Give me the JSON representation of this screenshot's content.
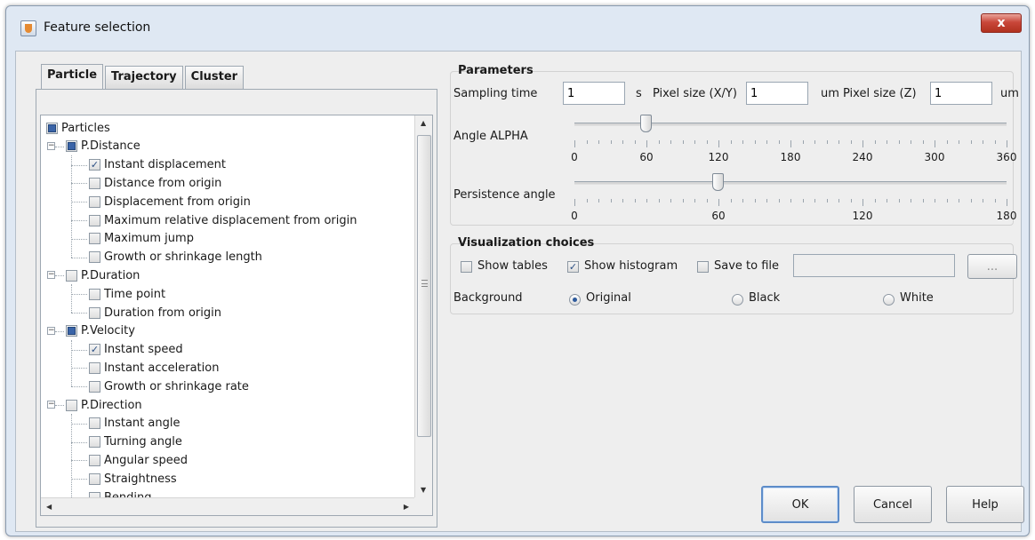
{
  "window": {
    "title": "Feature selection",
    "close_glyph": "x"
  },
  "tabs": [
    {
      "label": "Particle",
      "active": true
    },
    {
      "label": "Trajectory",
      "active": false
    },
    {
      "label": "Cluster",
      "active": false
    }
  ],
  "tree": {
    "root": {
      "label": "Particles",
      "state": "partial"
    },
    "groups": [
      {
        "label": "P.Distance",
        "state": "partial",
        "items": [
          {
            "label": "Instant displacement",
            "checked": true
          },
          {
            "label": "Distance from origin",
            "checked": false
          },
          {
            "label": "Displacement from origin",
            "checked": false
          },
          {
            "label": "Maximum relative displacement from origin",
            "checked": false
          },
          {
            "label": "Maximum jump",
            "checked": false
          },
          {
            "label": "Growth or shrinkage length",
            "checked": false
          }
        ]
      },
      {
        "label": "P.Duration",
        "state": "unchecked",
        "items": [
          {
            "label": "Time point",
            "checked": false
          },
          {
            "label": "Duration from origin",
            "checked": false
          }
        ]
      },
      {
        "label": "P.Velocity",
        "state": "partial",
        "items": [
          {
            "label": "Instant speed",
            "checked": true
          },
          {
            "label": "Instant acceleration",
            "checked": false
          },
          {
            "label": "Growth or shrinkage rate",
            "checked": false
          }
        ]
      },
      {
        "label": "P.Direction",
        "state": "unchecked",
        "items": [
          {
            "label": "Instant angle",
            "checked": false
          },
          {
            "label": "Turning angle",
            "checked": false
          },
          {
            "label": "Angular speed",
            "checked": false
          },
          {
            "label": "Straightness",
            "checked": false
          },
          {
            "label": "Bending",
            "checked": false
          }
        ]
      }
    ]
  },
  "parameters": {
    "title": "Parameters",
    "sampling_time": {
      "label": "Sampling time",
      "value": "1",
      "unit": "s"
    },
    "pixel_size_xy": {
      "label": "Pixel size (X/Y)",
      "value": "1",
      "unit": "um"
    },
    "pixel_size_z": {
      "label": "Pixel size (Z)",
      "value": "1",
      "unit": "um"
    },
    "angle_alpha": {
      "label": "Angle ALPHA",
      "value": 60,
      "min": 0,
      "max": 360,
      "ticks": [
        "0",
        "60",
        "120",
        "180",
        "240",
        "300",
        "360"
      ]
    },
    "persistence_angle": {
      "label": "Persistence angle",
      "value": 60,
      "min": 0,
      "max": 180,
      "ticks": [
        "0",
        "60",
        "120",
        "180"
      ]
    }
  },
  "visualization": {
    "title": "Visualization choices",
    "show_tables": {
      "label": "Show tables",
      "checked": false
    },
    "show_histogram": {
      "label": "Show histogram",
      "checked": true
    },
    "save_to_file": {
      "label": "Save to file",
      "checked": false
    },
    "file_path": "",
    "browse_label": "...",
    "background_label": "Background",
    "background_options": [
      {
        "label": "Original",
        "selected": true
      },
      {
        "label": "Black",
        "selected": false
      },
      {
        "label": "White",
        "selected": false
      }
    ]
  },
  "buttons": {
    "ok": "OK",
    "cancel": "Cancel",
    "help": "Help"
  }
}
